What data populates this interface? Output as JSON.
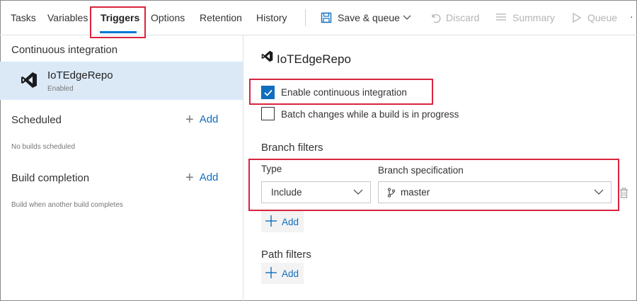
{
  "tabs": [
    {
      "label": "Tasks"
    },
    {
      "label": "Variables"
    },
    {
      "label": "Triggers"
    },
    {
      "label": "Options"
    },
    {
      "label": "Retention"
    },
    {
      "label": "History"
    }
  ],
  "toolbar": {
    "save_label": "Save & queue",
    "discard_label": "Discard",
    "summary_label": "Summary",
    "queue_label": "Queue",
    "more_label": "·"
  },
  "left_panel": {
    "ci_title": "Continuous integration",
    "repo_name": "IoTEdgeRepo",
    "repo_status": "Enabled",
    "scheduled_title": "Scheduled",
    "scheduled_add": "Add",
    "scheduled_note": "No builds scheduled",
    "completion_title": "Build completion",
    "completion_add": "Add",
    "completion_note": "Build when another build completes"
  },
  "right_panel": {
    "title": "IoTEdgeRepo",
    "enable_ci_label": "Enable continuous integration",
    "enable_ci_checked": true,
    "batch_label": "Batch changes while a build is in progress",
    "batch_checked": false,
    "branch_filters_title": "Branch filters",
    "type_label": "Type",
    "type_value": "Include",
    "branch_spec_label": "Branch specification",
    "branch_spec_value": "master",
    "branch_add_label": "Add",
    "path_filters_title": "Path filters",
    "path_add_label": "Add"
  },
  "colors": {
    "accent": "#0078d4",
    "highlight": "#d9243d",
    "selected_row": "#dbe9f7",
    "vs_logo": "#1b1b1b"
  },
  "icons": [
    "save-icon",
    "chevron-down-icon",
    "discard-icon",
    "summary-icon",
    "queue-icon",
    "visual-studio-icon",
    "plus-icon",
    "branch-icon",
    "trash-icon",
    "check-icon"
  ]
}
